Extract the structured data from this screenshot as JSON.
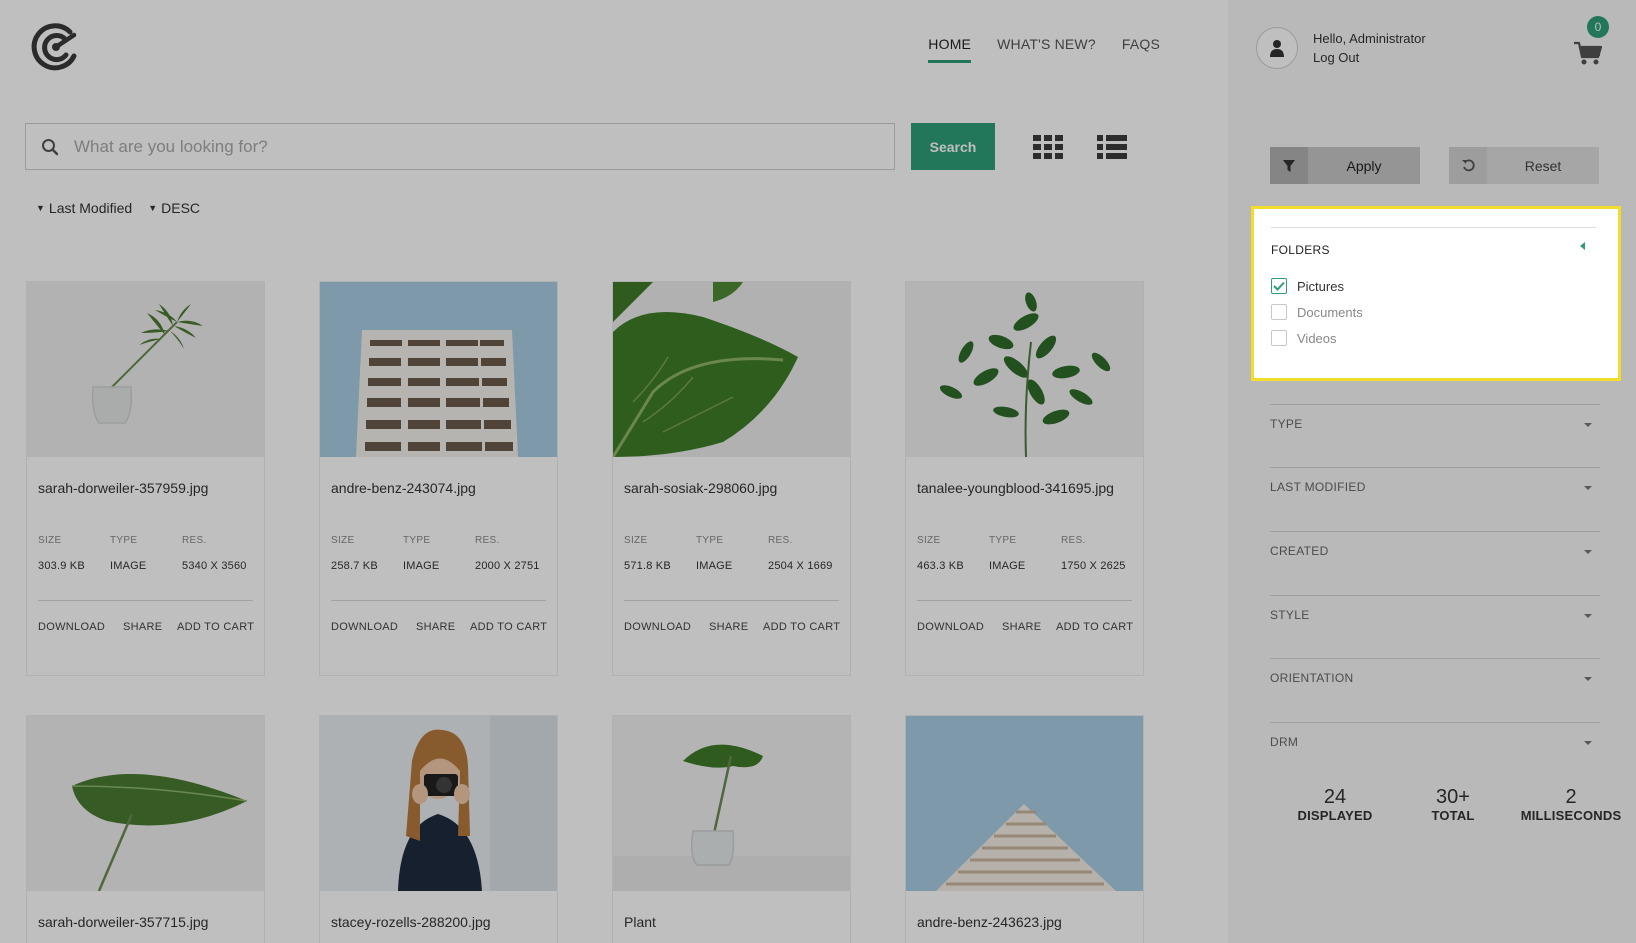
{
  "header": {
    "nav": [
      {
        "label": "HOME"
      },
      {
        "label": "WHAT'S NEW?"
      },
      {
        "label": "FAQS"
      }
    ]
  },
  "search": {
    "placeholder": "What are you looking for?",
    "button_label": "Search"
  },
  "sort": {
    "field": "Last Modified",
    "order": "DESC"
  },
  "cards": [
    {
      "filename": "sarah-dorweiler-357959.jpg",
      "size": "303.9 KB",
      "type": "IMAGE",
      "res": "5340 X 3560"
    },
    {
      "filename": "andre-benz-243074.jpg",
      "size": "258.7 KB",
      "type": "IMAGE",
      "res": "2000 X 2751"
    },
    {
      "filename": "sarah-sosiak-298060.jpg",
      "size": "571.8 KB",
      "type": "IMAGE",
      "res": "2504 X 1669"
    },
    {
      "filename": "tanalee-youngblood-341695.jpg",
      "size": "463.3 KB",
      "type": "IMAGE",
      "res": "1750 X 2625"
    },
    {
      "filename": "sarah-dorweiler-357715.jpg"
    },
    {
      "filename": "stacey-rozells-288200.jpg"
    },
    {
      "filename": "Plant"
    },
    {
      "filename": "andre-benz-243623.jpg"
    }
  ],
  "card_labels": {
    "size": "SIZE",
    "type": "TYPE",
    "res": "RES.",
    "download": "DOWNLOAD",
    "share": "SHARE",
    "add_to_cart": "ADD TO CART"
  },
  "user": {
    "greeting": "Hello, Administrator",
    "logout": "Log Out",
    "cart_count": "0"
  },
  "filters": {
    "apply_label": "Apply",
    "reset_label": "Reset",
    "folders": {
      "title": "FOLDERS",
      "items": [
        {
          "label": "Pictures",
          "checked": true
        },
        {
          "label": "Documents",
          "checked": false
        },
        {
          "label": "Videos",
          "checked": false
        }
      ]
    },
    "sections": [
      {
        "label": "TYPE"
      },
      {
        "label": "LAST MODIFIED"
      },
      {
        "label": "CREATED"
      },
      {
        "label": "STYLE"
      },
      {
        "label": "ORIENTATION"
      },
      {
        "label": "DRM"
      }
    ]
  },
  "stats": [
    {
      "value": "24",
      "label": "DISPLAYED"
    },
    {
      "value": "30+",
      "label": "TOTAL"
    },
    {
      "value": "2",
      "label": "MILLISECONDS"
    }
  ],
  "colors": {
    "accent": "#2e9e78",
    "highlight": "#f3dd2b"
  }
}
